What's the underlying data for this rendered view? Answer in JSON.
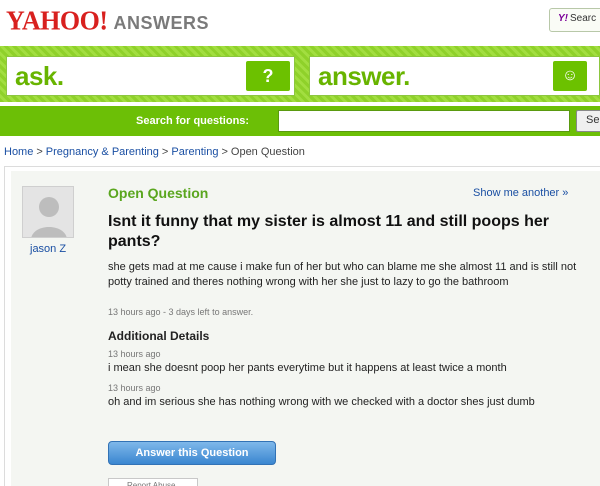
{
  "header": {
    "logo_yahoo": "YAHOO!",
    "logo_answers": "ANSWERS",
    "search_button_label": "Searc"
  },
  "band": {
    "ask_label": "ask.",
    "ask_icon_glyph": "?",
    "answer_label": "answer.",
    "answer_icon_glyph": "☺"
  },
  "searchbar": {
    "label": "Search for questions:",
    "input_value": "",
    "go_label": "Se"
  },
  "breadcrumb": [
    {
      "label": "Home",
      "link": true
    },
    {
      "label": "Pregnancy & Parenting",
      "link": true
    },
    {
      "label": "Parenting",
      "link": true
    },
    {
      "label": "Open Question",
      "link": false
    }
  ],
  "question": {
    "username": "jason Z",
    "status": "Open Question",
    "show_another": "Show me another »",
    "title": "Isnt it funny that my sister is almost 11 and still poops her pants?",
    "body": "she gets mad at me cause i make fun of her but who can blame me she almost 11 and is still not potty trained and theres nothing wrong with her she just to lazy to go the bathroom",
    "meta": "13 hours ago - 3 days left to answer."
  },
  "additional": {
    "heading": "Additional Details",
    "details": [
      {
        "time": "13 hours ago",
        "text": "i mean she doesnt poop her pants everytime but it happens at least twice a month"
      },
      {
        "time": "13 hours ago",
        "text": "oh and im serious she has nothing wrong with we checked with a doctor shes just dumb"
      }
    ]
  },
  "actions": {
    "answer_button": "Answer this Question",
    "tab_stub": "Report Abuse"
  },
  "colors": {
    "brand_red": "#d8201e",
    "green": "#6cbf06",
    "link_blue": "#1a4fa3",
    "status_green": "#5aa61e"
  }
}
